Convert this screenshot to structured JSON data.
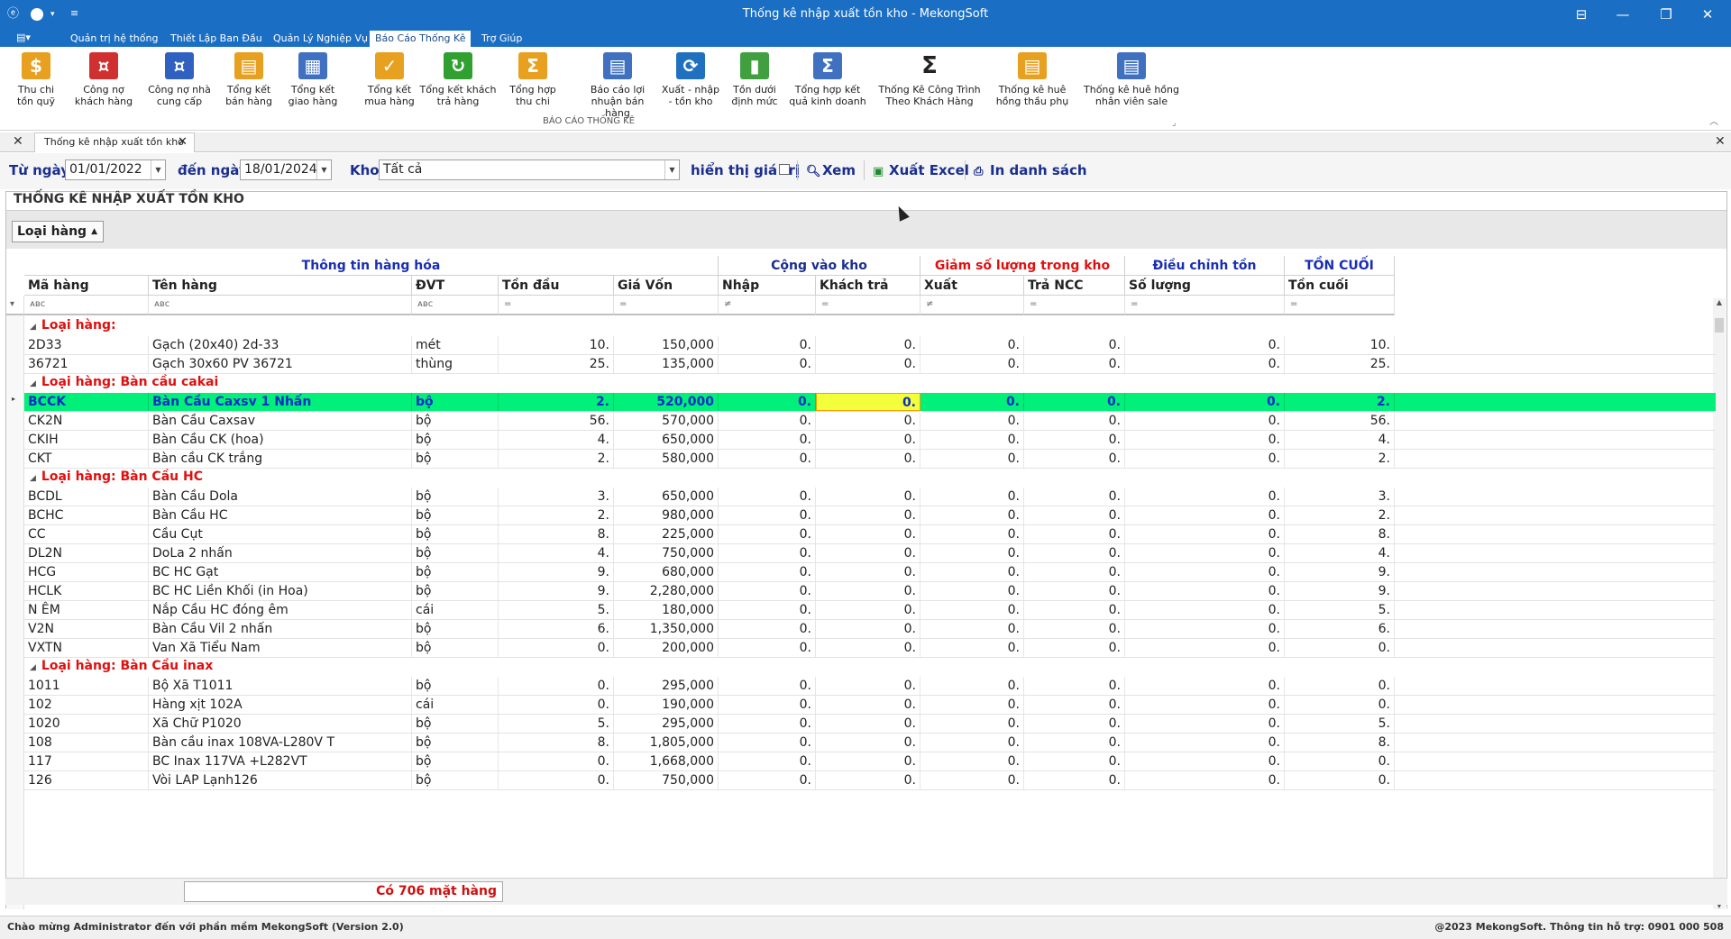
{
  "window": {
    "title": "Thống kê nhập xuất tồn kho - MekongSoft",
    "controls": [
      "⊟",
      "—",
      "❐",
      "✕"
    ]
  },
  "ribbon_tabs": [
    "Quản trị hệ thống",
    "Thiết Lập Ban Đầu",
    "Quản Lý Nghiệp Vụ",
    "Báo Cáo Thống Kê",
    "Trợ Giúp"
  ],
  "ribbon": {
    "group_label": "BÁO CÁO THỐNG KÊ",
    "buttons": [
      {
        "label": "Thu chi\ntồn quỹ",
        "icon": "coins-icon",
        "color": "#e8a020"
      },
      {
        "label": "Công nợ\nkhách hàng",
        "icon": "customer-debt-icon",
        "color": "#d03030"
      },
      {
        "label": "Công nợ nhà\ncung cấp",
        "icon": "supplier-debt-icon",
        "color": "#3060c0"
      },
      {
        "label": "Tổng kết\nbán hàng",
        "icon": "sales-summary-icon",
        "color": "#e8a020"
      },
      {
        "label": "Tổng kết\ngiao hàng",
        "icon": "delivery-summary-icon",
        "color": "#4070c0"
      },
      {
        "label": "Tổng kết\nmua hàng",
        "icon": "purchase-summary-icon",
        "color": "#e8a020"
      },
      {
        "label": "Tổng kết khách\ntrả hàng",
        "icon": "customer-return-icon",
        "color": "#30a030"
      },
      {
        "label": "Tổng hợp\nthu chi",
        "icon": "sigma-sum-icon",
        "color": "#e8a020"
      },
      {
        "label": "Báo cáo lợi\nnhuận bán hàng",
        "icon": "profit-report-icon",
        "color": "#4070c0"
      },
      {
        "label": "Xuất - nhập\n- tồn kho",
        "icon": "inventory-cycle-icon",
        "color": "#2070c0"
      },
      {
        "label": "Tồn dưới\nđịnh mức",
        "icon": "bar-chart-icon",
        "color": "#40a040"
      },
      {
        "label": "Tổng hợp kết\nquả kinh doanh",
        "icon": "business-result-icon",
        "color": "#4070c0"
      },
      {
        "label": "Thống Kê Công Trình\nTheo Khách Hàng",
        "icon": "sigma-icon",
        "color": "#222222"
      },
      {
        "label": "Thống kê huê\nhồng thầu phụ",
        "icon": "commission-icon",
        "color": "#e8a020"
      },
      {
        "label": "Thống kê huê hồng\nnhân viên sale",
        "icon": "staff-commission-icon",
        "color": "#4070c0"
      }
    ]
  },
  "doc_tab": {
    "label": "Thống kê nhập xuất tồn kho"
  },
  "filter": {
    "from_label": "Từ ngày",
    "from_value": "01/01/2022",
    "to_label": "đến ngày",
    "to_value": "18/01/2024",
    "warehouse_label": "Kho",
    "warehouse_value": "Tất cả",
    "show_value_label": "hiển thị giá trị",
    "show_value_checked": false,
    "view_button": "Xem",
    "export_button": "Xuất Excel",
    "print_button": "In danh sách"
  },
  "panel_title": "THỐNG KÊ NHẬP XUẤT TỒN KHO",
  "group_chip": "Loại hàng",
  "bands": [
    {
      "label": "Thông tin hàng hóa",
      "color": "#1a2eb0"
    },
    {
      "label": "Cộng vào kho",
      "color": "#1a2e8f"
    },
    {
      "label": "Giảm số lượng trong kho",
      "color": "#e01010"
    },
    {
      "label": "Điều chỉnh tồn",
      "color": "#1a2eb0"
    },
    {
      "label": "TỒN CUỐI",
      "color": "#1a2eb0"
    }
  ],
  "columns": [
    "Mã hàng",
    "Tên hàng",
    "ĐVT",
    "Tồn đầu",
    "Giá Vốn",
    "Nhập",
    "Khách trả",
    "Xuất",
    "Trả NCC",
    "Số lượng",
    "Tồn cuối"
  ],
  "filter_row_symbols": [
    "ᴀʙc",
    "ᴀʙc",
    "ᴀʙc",
    "=",
    "=",
    "≠",
    "=",
    "≠",
    "=",
    "=",
    "="
  ],
  "groups": [
    {
      "label": "Loại hàng:",
      "rows": [
        [
          "2D33",
          "Gạch (20x40) 2d-33",
          "mét",
          "10.",
          "150,000",
          "0.",
          "0.",
          "0.",
          "0.",
          "0.",
          "10."
        ],
        [
          "36721",
          "Gạch 30x60 PV 36721",
          "thùng",
          "25.",
          "135,000",
          "0.",
          "0.",
          "0.",
          "0.",
          "0.",
          "25."
        ]
      ]
    },
    {
      "label": "Loại hàng: Bàn cầu cakai",
      "rows": [
        [
          "BCCK",
          "Bàn Cầu Caxsv 1 Nhấn",
          "bộ",
          "2.",
          "520,000",
          "0.",
          "0.",
          "0.",
          "0.",
          "0.",
          "2."
        ],
        [
          "CK2N",
          "Bàn Cầu Caxsav",
          "bộ",
          "56.",
          "570,000",
          "0.",
          "0.",
          "0.",
          "0.",
          "0.",
          "56."
        ],
        [
          "CKIH",
          "Bàn Cầu CK (hoa)",
          "bộ",
          "4.",
          "650,000",
          "0.",
          "0.",
          "0.",
          "0.",
          "0.",
          "4."
        ],
        [
          "CKT",
          "Bàn cầu CK trắng",
          "bộ",
          "2.",
          "580,000",
          "0.",
          "0.",
          "0.",
          "0.",
          "0.",
          "2."
        ]
      ]
    },
    {
      "label": "Loại hàng: Bàn Cầu HC",
      "rows": [
        [
          "BCDL",
          "Bàn Cầu Dola",
          "bộ",
          "3.",
          "650,000",
          "0.",
          "0.",
          "0.",
          "0.",
          "0.",
          "3."
        ],
        [
          "BCHC",
          "Bàn Cầu HC",
          "bộ",
          "2.",
          "980,000",
          "0.",
          "0.",
          "0.",
          "0.",
          "0.",
          "2."
        ],
        [
          "CC",
          "Cầu Cụt",
          "bộ",
          "8.",
          "225,000",
          "0.",
          "0.",
          "0.",
          "0.",
          "0.",
          "8."
        ],
        [
          "DL2N",
          "DoLa 2 nhấn",
          "bộ",
          "4.",
          "750,000",
          "0.",
          "0.",
          "0.",
          "0.",
          "0.",
          "4."
        ],
        [
          "HCG",
          "BC HC Gạt",
          "bộ",
          "9.",
          "680,000",
          "0.",
          "0.",
          "0.",
          "0.",
          "0.",
          "9."
        ],
        [
          "HCLK",
          "BC HC Liền Khối (in Hoa)",
          "bộ",
          "9.",
          "2,280,000",
          "0.",
          "0.",
          "0.",
          "0.",
          "0.",
          "9."
        ],
        [
          "N ÊM",
          "Nắp Cầu HC đóng êm",
          "cái",
          "5.",
          "180,000",
          "0.",
          "0.",
          "0.",
          "0.",
          "0.",
          "5."
        ],
        [
          "V2N",
          "Bàn Cầu Vil 2 nhấn",
          "bộ",
          "6.",
          "1,350,000",
          "0.",
          "0.",
          "0.",
          "0.",
          "0.",
          "6."
        ],
        [
          "VXTN",
          "Van Xã Tiểu Nam",
          "bộ",
          "0.",
          "200,000",
          "0.",
          "0.",
          "0.",
          "0.",
          "0.",
          "0."
        ]
      ]
    },
    {
      "label": "Loại hàng: Bàn Cầu inax",
      "rows": [
        [
          "1011",
          "Bộ Xã T1011",
          "bộ",
          "0.",
          "295,000",
          "0.",
          "0.",
          "0.",
          "0.",
          "0.",
          "0."
        ],
        [
          "102",
          "Hàng xịt 102A",
          "cái",
          "0.",
          "190,000",
          "0.",
          "0.",
          "0.",
          "0.",
          "0.",
          "0."
        ],
        [
          "1020",
          "Xã Chữ P1020",
          "bộ",
          "5.",
          "295,000",
          "0.",
          "0.",
          "0.",
          "0.",
          "0.",
          "5."
        ],
        [
          "108",
          "Bàn cầu inax 108VA-L280V T",
          "bộ",
          "8.",
          "1,805,000",
          "0.",
          "0.",
          "0.",
          "0.",
          "0.",
          "8."
        ],
        [
          "117",
          "BC Inax 117VA +L282VT",
          "bộ",
          "0.",
          "1,668,000",
          "0.",
          "0.",
          "0.",
          "0.",
          "0.",
          "0."
        ],
        [
          "126",
          "Vòi LAP Lạnh126",
          "bộ",
          "0.",
          "750,000",
          "0.",
          "0.",
          "0.",
          "0.",
          "0.",
          "0."
        ]
      ]
    }
  ],
  "footer_count": "Có 706 mặt hàng",
  "status": {
    "left": "Chào mừng Administrator đến với phần mềm MekongSoft (Version 2.0)",
    "right": "@2023 MekongSoft. Thông tin hỗ trợ: 0901 000 508"
  },
  "colors": {
    "accent": "#1a6fc4",
    "selected_row": "#00f07a",
    "focus_cell": "#f3ff3a",
    "group_label": "#e01010"
  }
}
